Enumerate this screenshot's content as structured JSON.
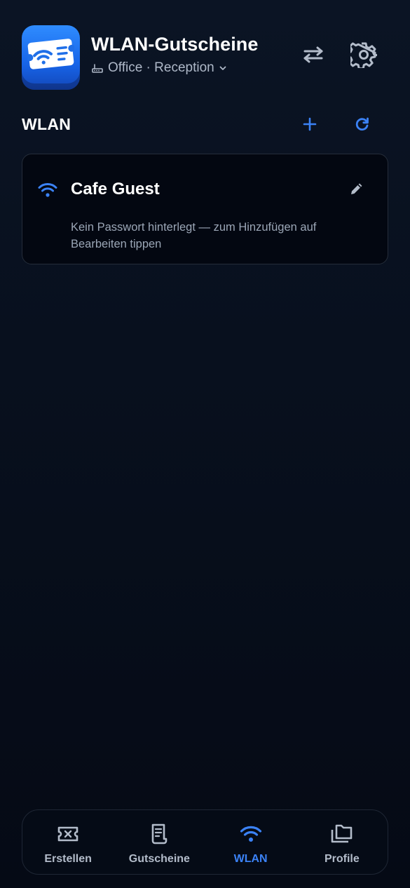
{
  "header": {
    "app_title": "WLAN-Gutscheine",
    "profile_selector": {
      "label": "Office · Reception",
      "icon": "router-icon"
    },
    "actions": [
      {
        "name": "swap",
        "icon": "swap-arrows-icon"
      },
      {
        "name": "settings",
        "icon": "gear-icon"
      }
    ]
  },
  "section": {
    "title": "WLAN",
    "add_icon": "plus-icon",
    "refresh_icon": "refresh-icon"
  },
  "networks": [
    {
      "name": "Cafe Guest",
      "icon": "wifi-icon",
      "edit_icon": "pencil-icon",
      "note": "Kein Passwort hinterlegt — zum Hinzufügen auf Bearbeiten tippen"
    }
  ],
  "bottom_nav": [
    {
      "label": "Erstellen",
      "icon": "ticket-icon",
      "active": false
    },
    {
      "label": "Gutscheine",
      "icon": "receipt-icon",
      "active": false
    },
    {
      "label": "WLAN",
      "icon": "wifi-icon",
      "active": true
    },
    {
      "label": "Profile",
      "icon": "folders-icon",
      "active": false
    }
  ],
  "colors": {
    "accent": "#3b82f6",
    "background": "#070d1a",
    "card_border": "#252d3a",
    "muted_text": "#9ba6b6"
  }
}
